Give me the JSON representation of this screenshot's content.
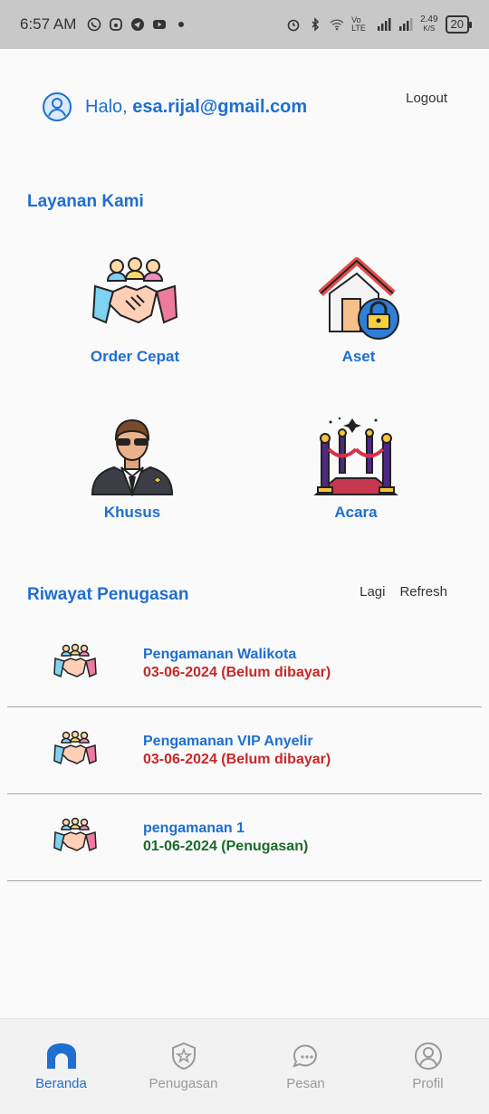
{
  "status_bar": {
    "time": "6:57 AM",
    "speed_value": "2.49",
    "speed_unit": "K/S",
    "battery": "20",
    "volte": "Vo LTE"
  },
  "header": {
    "greeting": "Halo,",
    "email": "esa.rijal@gmail.com",
    "logout_label": "Logout"
  },
  "services": {
    "title": "Layanan Kami",
    "items": [
      {
        "label": "Order Cepat",
        "icon": "handshake-icon"
      },
      {
        "label": "Aset",
        "icon": "house-lock-icon"
      },
      {
        "label": "Khusus",
        "icon": "bodyguard-icon"
      },
      {
        "label": "Acara",
        "icon": "red-carpet-icon"
      }
    ]
  },
  "history": {
    "title": "Riwayat Penugasan",
    "more_label": "Lagi",
    "refresh_label": "Refresh",
    "items": [
      {
        "title": "Pengamanan Walikota",
        "status": "03-06-2024 (Belum dibayar)",
        "status_color": "#c62828"
      },
      {
        "title": "Pengamanan VIP Anyelir",
        "status": "03-06-2024 (Belum dibayar)",
        "status_color": "#c62828"
      },
      {
        "title": "pengamanan 1",
        "status": "01-06-2024 (Penugasan)",
        "status_color": "#1b6b2a"
      }
    ]
  },
  "bottom_nav": {
    "items": [
      {
        "label": "Beranda",
        "icon": "home-icon",
        "active": true
      },
      {
        "label": "Penugasan",
        "icon": "shield-star-icon",
        "active": false
      },
      {
        "label": "Pesan",
        "icon": "chat-icon",
        "active": false
      },
      {
        "label": "Profil",
        "icon": "user-icon",
        "active": false
      }
    ]
  },
  "colors": {
    "primary": "#1e6fd0",
    "unpaid": "#c62828",
    "assigned": "#1b6b2a"
  }
}
